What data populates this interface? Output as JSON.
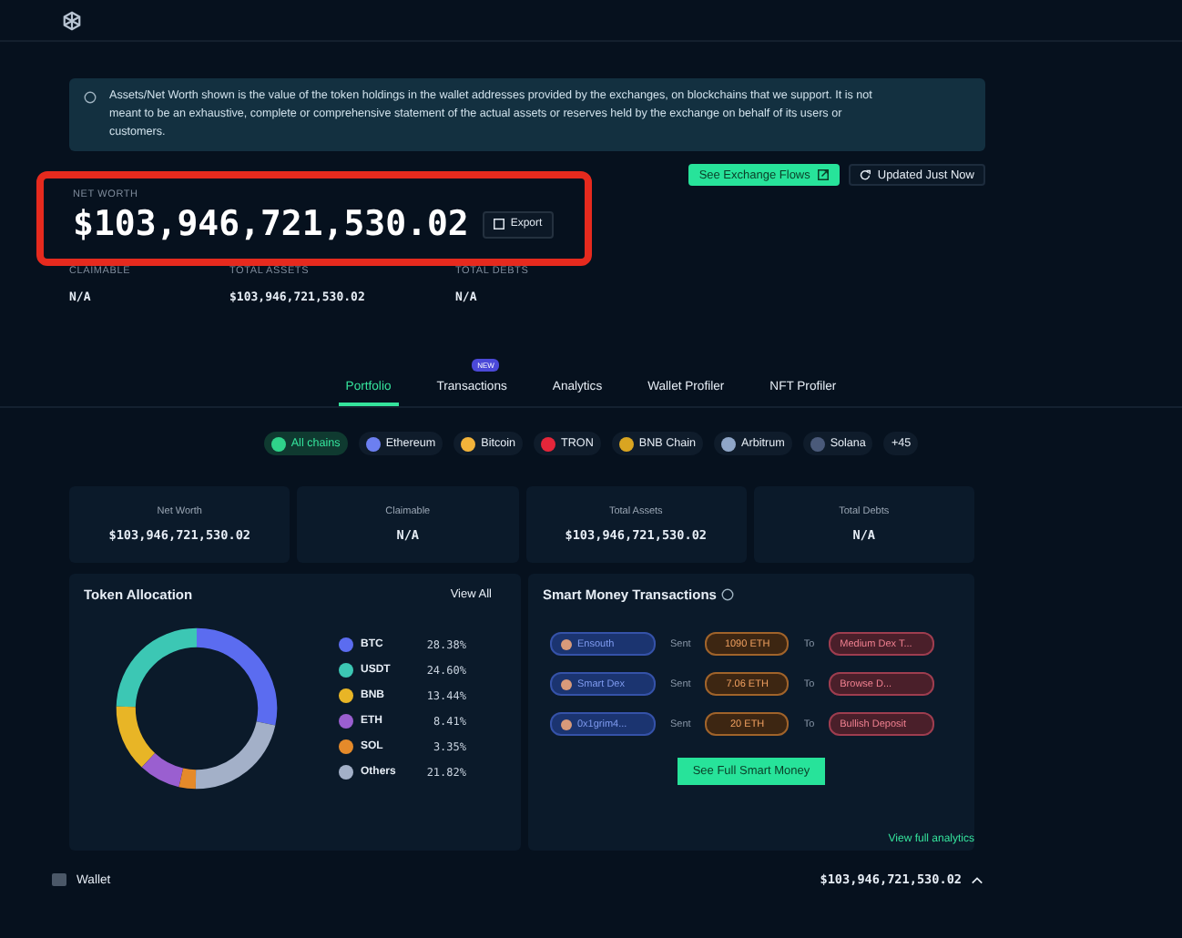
{
  "notice": {
    "text": "Assets/Net Worth shown is the value of the token holdings in the wallet addresses provided by the exchanges, on blockchains that we support. It is not meant to be an exhaustive, complete or comprehensive statement of the actual assets or reserves held by the exchange on behalf of its users or customers."
  },
  "actions": [
    {
      "label": "See Exchange Flows",
      "kind": "primary"
    },
    {
      "label": "Updated Just Now",
      "kind": "refresh"
    }
  ],
  "net_worth": {
    "label": "NET WORTH",
    "value": "$103,946,721,530.02",
    "export": "Export",
    "highlighted": true
  },
  "stats": [
    {
      "label": "CLAIMABLE",
      "value": "N/A"
    },
    {
      "label": "TOTAL ASSETS",
      "value": "$103,946,721,530.02"
    },
    {
      "label": "TOTAL DEBTS",
      "value": "N/A"
    }
  ],
  "tabs": [
    {
      "label": "Portfolio",
      "selected": true
    },
    {
      "label": "Transactions",
      "selected": false,
      "badge": "NEW"
    },
    {
      "label": "Analytics",
      "selected": false
    },
    {
      "label": "Wallet Profiler",
      "selected": false
    },
    {
      "label": "NFT Profiler",
      "selected": false
    }
  ],
  "chains": [
    {
      "label": "All chains",
      "selected": true,
      "color": "#2fd38a"
    },
    {
      "label": "Ethereum",
      "selected": false,
      "color": "#6c7ff0"
    },
    {
      "label": "Bitcoin",
      "selected": false,
      "color": "#f2b33a"
    },
    {
      "label": "TRON",
      "selected": false,
      "color": "#e5263a"
    },
    {
      "label": "BNB Chain",
      "selected": false,
      "color": "#d9a521"
    },
    {
      "label": "Arbitrum",
      "selected": false,
      "color": "#8fa6c8"
    },
    {
      "label": "Solana",
      "selected": false,
      "color": "#4a5a7a"
    },
    {
      "label": "+45",
      "selected": false
    }
  ],
  "cards": [
    {
      "label": "Net Worth",
      "value": "$103,946,721,530.02"
    },
    {
      "label": "Claimable",
      "value": "N/A"
    },
    {
      "label": "Total Assets",
      "value": "$103,946,721,530.02"
    },
    {
      "label": "Total Debts",
      "value": "N/A"
    }
  ],
  "token_allocation": {
    "title": "Token Allocation",
    "view_all": "View All",
    "chart_data": {
      "type": "donut",
      "categories": [
        "BTC",
        "USDT",
        "BNB",
        "ETH",
        "SOL",
        "Others"
      ],
      "values": [
        28.38,
        24.6,
        13.44,
        8.41,
        3.35,
        21.82
      ]
    },
    "tokens": [
      {
        "share": "28.38%",
        "color": "#5b6cf0"
      },
      {
        "share": "24.60%",
        "color": "#3cc7b4"
      },
      {
        "share": "13.44%",
        "color": "#e8b526"
      },
      {
        "share": "8.41%",
        "color": "#9a5fd0"
      },
      {
        "share": "3.35%",
        "color": "#e58a2a"
      },
      {
        "share": "21.82%",
        "color": "#a3b0c8"
      }
    ]
  },
  "smart_money": {
    "title": "Smart Money Transactions",
    "rows": [
      {
        "from": "Ensouth",
        "verb": "Sent",
        "amount": "1090 ETH",
        "to_word": "To",
        "to": "Medium Dex T..."
      },
      {
        "from": "Smart Dex",
        "verb": "Sent",
        "amount": "7.06 ETH",
        "to_word": "To",
        "to": "Browse D..."
      },
      {
        "from": "0x1grim4...",
        "verb": "Sent",
        "amount": "20 ETH",
        "to_word": "To",
        "to": "Bullish Deposit"
      }
    ],
    "button": "See Full Smart Money"
  },
  "view_full": "View full analytics",
  "wallet": {
    "label": "Wallet",
    "value": "$103,946,721,530.02",
    "expanded": true
  }
}
